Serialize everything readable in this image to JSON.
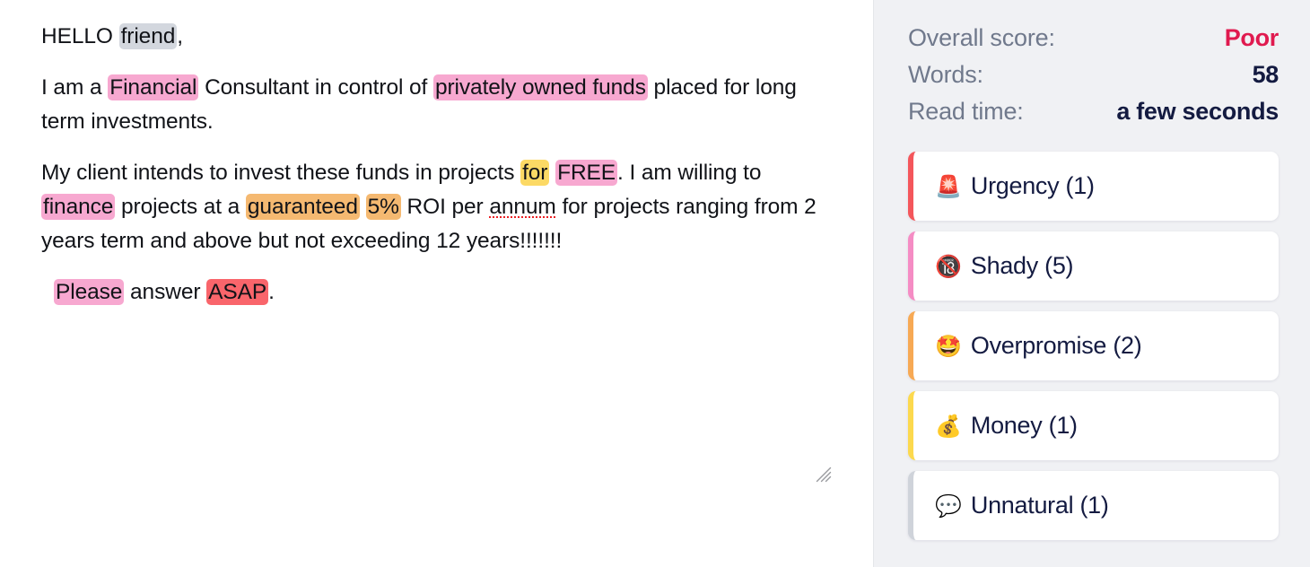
{
  "editor": {
    "resize_grip_icon": "resize-grip-icon",
    "paragraphs": [
      {
        "id": "greeting",
        "indent": false,
        "runs": [
          {
            "text": "HELLO ",
            "highlight": "none"
          },
          {
            "text": "friend",
            "highlight": "grey"
          },
          {
            "text": ",",
            "highlight": "none"
          }
        ]
      },
      {
        "id": "intro",
        "indent": false,
        "runs": [
          {
            "text": "I am a ",
            "highlight": "none"
          },
          {
            "text": "Financial",
            "highlight": "pink"
          },
          {
            "text": " Consultant in control of ",
            "highlight": "none"
          },
          {
            "text": "privately owned funds",
            "highlight": "pink"
          },
          {
            "text": " placed for long term investments.",
            "highlight": "none"
          }
        ]
      },
      {
        "id": "offer",
        "indent": false,
        "runs": [
          {
            "text": "My client intends to invest these funds in projects ",
            "highlight": "none"
          },
          {
            "text": "for",
            "highlight": "yellow"
          },
          {
            "text": " ",
            "highlight": "none"
          },
          {
            "text": "FREE",
            "highlight": "pink"
          },
          {
            "text": ". I am willing to ",
            "highlight": "none"
          },
          {
            "text": "finance",
            "highlight": "pink"
          },
          {
            "text": " projects at a ",
            "highlight": "none"
          },
          {
            "text": "guaranteed",
            "highlight": "orange"
          },
          {
            "text": " ",
            "highlight": "none"
          },
          {
            "text": "5%",
            "highlight": "orange"
          },
          {
            "text": " ROI per ",
            "highlight": "none"
          },
          {
            "text": "annum",
            "highlight": "none",
            "misspelled": true
          },
          {
            "text": " for projects ranging from 2 years term and above but not exceeding 12 years!!!!!!!",
            "highlight": "none"
          }
        ]
      },
      {
        "id": "closing",
        "indent": true,
        "runs": [
          {
            "text": "Please",
            "highlight": "pink"
          },
          {
            "text": " answer ",
            "highlight": "none"
          },
          {
            "text": "ASAP",
            "highlight": "red"
          },
          {
            "text": ".",
            "highlight": "none"
          }
        ]
      }
    ]
  },
  "sidebar": {
    "stats": [
      {
        "label": "Overall score:",
        "value": "Poor",
        "tone": "poor"
      },
      {
        "label": "Words:",
        "value": "58",
        "tone": "normal"
      },
      {
        "label": "Read time:",
        "value": "a few seconds",
        "tone": "normal"
      }
    ],
    "cards": [
      {
        "emoji": "🚨",
        "icon_name": "siren-icon",
        "label": "Urgency (1)",
        "accent": "#f4565b"
      },
      {
        "emoji": "🔞",
        "icon_name": "no-one-under-eighteen-icon",
        "label": "Shady (5)",
        "accent": "#f58cc4"
      },
      {
        "emoji": "🤩",
        "icon_name": "star-struck-icon",
        "label": "Overpromise (2)",
        "accent": "#f7a954"
      },
      {
        "emoji": "💰",
        "icon_name": "money-bag-icon",
        "label": "Money (1)",
        "accent": "#fcd94e"
      },
      {
        "emoji": "💬",
        "icon_name": "speech-balloon-icon",
        "label": "Unnatural (1)",
        "accent": "#cfd3da"
      }
    ]
  },
  "colors": {
    "page_background": "#ffffff",
    "sidebar_background": "#f0f1f4",
    "text_primary": "#111318",
    "stat_label": "#70798c",
    "stat_value": "#141b41",
    "score_poor": "#e01a4f",
    "highlight_grey": "#d3d7de",
    "highlight_pink": "#f7a8d0",
    "highlight_orange": "#f5b971",
    "highlight_yellow": "#fcd965",
    "highlight_red": "#f9656b",
    "spellcheck_underline": "#ec2024"
  }
}
